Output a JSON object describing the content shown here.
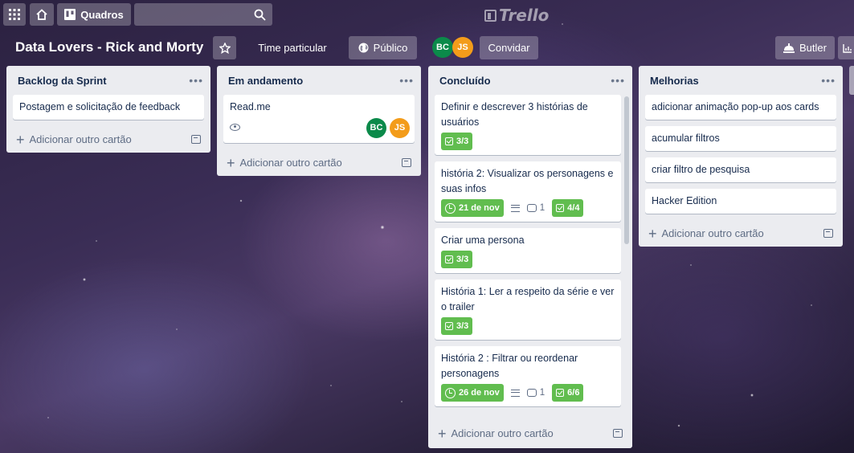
{
  "topbar": {
    "apps_icon": "grid-icon",
    "home_icon": "home-icon",
    "boards_label": "Quadros",
    "search_placeholder": "",
    "logo_text": "Trello"
  },
  "board": {
    "title": "Data Lovers - Rick and Morty",
    "team_label": "Time particular",
    "visibility_label": "Público",
    "invite_label": "Convidar",
    "butler_label": "Butler",
    "members": [
      {
        "initials": "BC",
        "color": "#0b8a4a"
      },
      {
        "initials": "JS",
        "color": "#f39c1a"
      }
    ]
  },
  "add_card_label": "Adicionar outro cartão",
  "lists": [
    {
      "title": "Backlog da Sprint",
      "cards": [
        {
          "title": "Postagem e solicitação de feedback"
        }
      ]
    },
    {
      "title": "Em andamento",
      "cards": [
        {
          "title": "Read.me",
          "watching": true,
          "members": [
            "BC",
            "JS"
          ]
        }
      ]
    },
    {
      "title": "Concluído",
      "cards": [
        {
          "title": "Definir e descrever 3 histórias de usuários",
          "checklist": "3/3"
        },
        {
          "title": "história 2: Visualizar os personagens e suas infos",
          "due": "21 de nov",
          "comments": "1",
          "checklist": "4/4"
        },
        {
          "title": "Criar uma persona",
          "checklist": "3/3"
        },
        {
          "title": "História 1: Ler a respeito da série e ver o trailer",
          "checklist": "3/3"
        },
        {
          "title": "História 2 : Filtrar ou reordenar personagens",
          "due": "26 de nov",
          "comments": "1",
          "checklist": "6/6"
        }
      ]
    },
    {
      "title": "Melhorias",
      "cards": [
        {
          "title": "adicionar animação pop-up aos cards"
        },
        {
          "title": "acumular filtros"
        },
        {
          "title": "criar filtro de pesquisa"
        },
        {
          "title": "Hacker Edition"
        }
      ]
    }
  ],
  "colors": {
    "list_bg": "#ebecf0",
    "badge_green": "#61bd4f",
    "text": "#172b4d"
  }
}
